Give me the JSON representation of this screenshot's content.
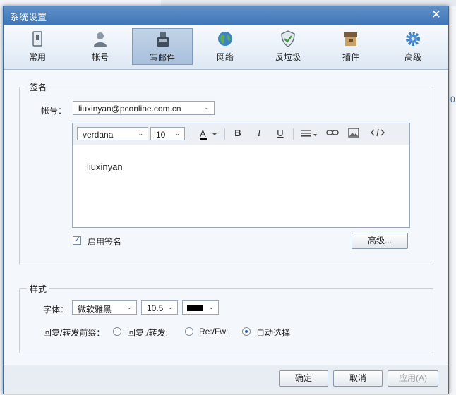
{
  "dialog": {
    "title": "系统设置"
  },
  "tabs": [
    {
      "label": "常用",
      "icon": "general-icon"
    },
    {
      "label": "帐号",
      "icon": "user-icon"
    },
    {
      "label": "写邮件",
      "icon": "compose-icon"
    },
    {
      "label": "网络",
      "icon": "globe-icon"
    },
    {
      "label": "反垃圾",
      "icon": "shield-icon"
    },
    {
      "label": "插件",
      "icon": "plugin-box-icon"
    },
    {
      "label": "高级",
      "icon": "gear-icon"
    }
  ],
  "active_tab": "写邮件",
  "signature": {
    "section_title": "签名",
    "account_label": "帐号：",
    "account_value": "liuxinyan@pconline.com.cn",
    "font_value": "verdana",
    "size_value": "10",
    "body_text": "liuxinyan",
    "enable_label": "启用签名",
    "enabled": true,
    "advanced_button": "高级..."
  },
  "style": {
    "section_title": "样式",
    "font_label": "字体：",
    "font_value": "微软雅黑",
    "size_value": "10.5",
    "color_value": "#000000",
    "prefix_label": "回复/转发前缀：",
    "options": [
      "回复:/转发:",
      "Re:/Fw:",
      "自动选择"
    ],
    "selected_option": "自动选择"
  },
  "footer": {
    "ok": "确定",
    "cancel": "取消",
    "apply": "应用(A)"
  },
  "background": {
    "zero_text": "0"
  }
}
